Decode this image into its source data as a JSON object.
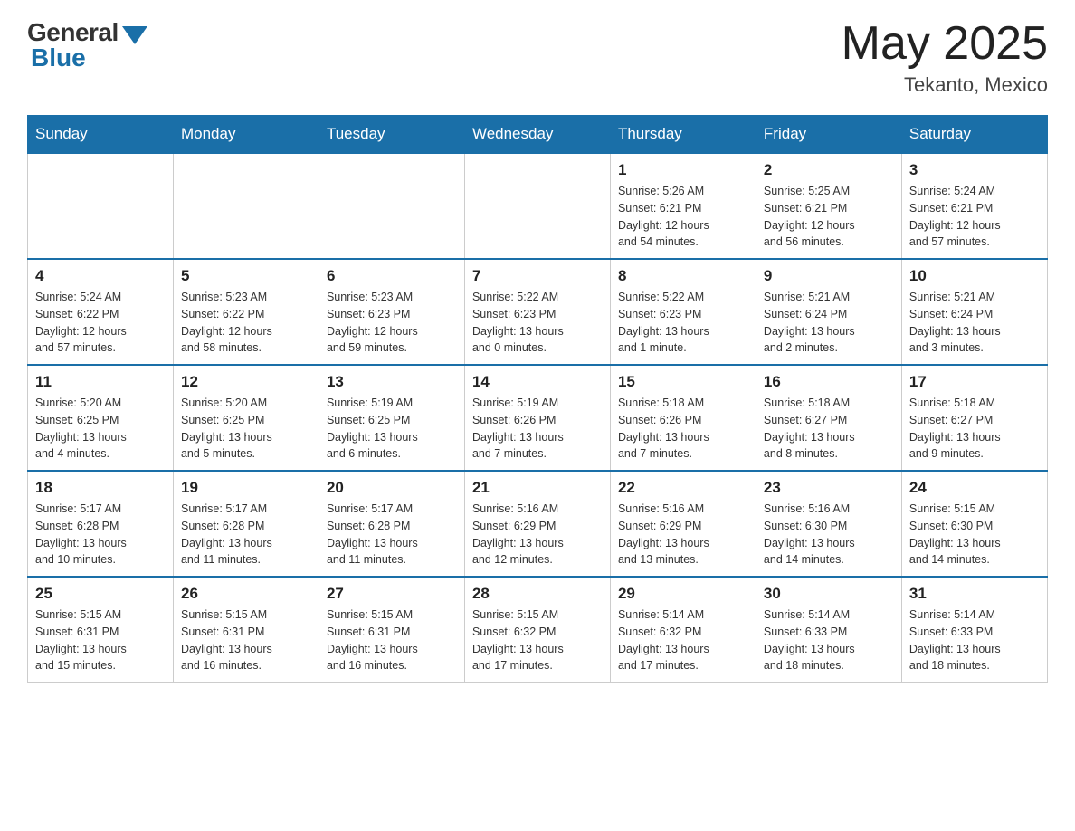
{
  "logo": {
    "general": "General",
    "blue": "Blue"
  },
  "title": {
    "month_year": "May 2025",
    "location": "Tekanto, Mexico"
  },
  "weekdays": [
    "Sunday",
    "Monday",
    "Tuesday",
    "Wednesday",
    "Thursday",
    "Friday",
    "Saturday"
  ],
  "weeks": [
    [
      {
        "day": "",
        "info": ""
      },
      {
        "day": "",
        "info": ""
      },
      {
        "day": "",
        "info": ""
      },
      {
        "day": "",
        "info": ""
      },
      {
        "day": "1",
        "info": "Sunrise: 5:26 AM\nSunset: 6:21 PM\nDaylight: 12 hours\nand 54 minutes."
      },
      {
        "day": "2",
        "info": "Sunrise: 5:25 AM\nSunset: 6:21 PM\nDaylight: 12 hours\nand 56 minutes."
      },
      {
        "day": "3",
        "info": "Sunrise: 5:24 AM\nSunset: 6:21 PM\nDaylight: 12 hours\nand 57 minutes."
      }
    ],
    [
      {
        "day": "4",
        "info": "Sunrise: 5:24 AM\nSunset: 6:22 PM\nDaylight: 12 hours\nand 57 minutes."
      },
      {
        "day": "5",
        "info": "Sunrise: 5:23 AM\nSunset: 6:22 PM\nDaylight: 12 hours\nand 58 minutes."
      },
      {
        "day": "6",
        "info": "Sunrise: 5:23 AM\nSunset: 6:23 PM\nDaylight: 12 hours\nand 59 minutes."
      },
      {
        "day": "7",
        "info": "Sunrise: 5:22 AM\nSunset: 6:23 PM\nDaylight: 13 hours\nand 0 minutes."
      },
      {
        "day": "8",
        "info": "Sunrise: 5:22 AM\nSunset: 6:23 PM\nDaylight: 13 hours\nand 1 minute."
      },
      {
        "day": "9",
        "info": "Sunrise: 5:21 AM\nSunset: 6:24 PM\nDaylight: 13 hours\nand 2 minutes."
      },
      {
        "day": "10",
        "info": "Sunrise: 5:21 AM\nSunset: 6:24 PM\nDaylight: 13 hours\nand 3 minutes."
      }
    ],
    [
      {
        "day": "11",
        "info": "Sunrise: 5:20 AM\nSunset: 6:25 PM\nDaylight: 13 hours\nand 4 minutes."
      },
      {
        "day": "12",
        "info": "Sunrise: 5:20 AM\nSunset: 6:25 PM\nDaylight: 13 hours\nand 5 minutes."
      },
      {
        "day": "13",
        "info": "Sunrise: 5:19 AM\nSunset: 6:25 PM\nDaylight: 13 hours\nand 6 minutes."
      },
      {
        "day": "14",
        "info": "Sunrise: 5:19 AM\nSunset: 6:26 PM\nDaylight: 13 hours\nand 7 minutes."
      },
      {
        "day": "15",
        "info": "Sunrise: 5:18 AM\nSunset: 6:26 PM\nDaylight: 13 hours\nand 7 minutes."
      },
      {
        "day": "16",
        "info": "Sunrise: 5:18 AM\nSunset: 6:27 PM\nDaylight: 13 hours\nand 8 minutes."
      },
      {
        "day": "17",
        "info": "Sunrise: 5:18 AM\nSunset: 6:27 PM\nDaylight: 13 hours\nand 9 minutes."
      }
    ],
    [
      {
        "day": "18",
        "info": "Sunrise: 5:17 AM\nSunset: 6:28 PM\nDaylight: 13 hours\nand 10 minutes."
      },
      {
        "day": "19",
        "info": "Sunrise: 5:17 AM\nSunset: 6:28 PM\nDaylight: 13 hours\nand 11 minutes."
      },
      {
        "day": "20",
        "info": "Sunrise: 5:17 AM\nSunset: 6:28 PM\nDaylight: 13 hours\nand 11 minutes."
      },
      {
        "day": "21",
        "info": "Sunrise: 5:16 AM\nSunset: 6:29 PM\nDaylight: 13 hours\nand 12 minutes."
      },
      {
        "day": "22",
        "info": "Sunrise: 5:16 AM\nSunset: 6:29 PM\nDaylight: 13 hours\nand 13 minutes."
      },
      {
        "day": "23",
        "info": "Sunrise: 5:16 AM\nSunset: 6:30 PM\nDaylight: 13 hours\nand 14 minutes."
      },
      {
        "day": "24",
        "info": "Sunrise: 5:15 AM\nSunset: 6:30 PM\nDaylight: 13 hours\nand 14 minutes."
      }
    ],
    [
      {
        "day": "25",
        "info": "Sunrise: 5:15 AM\nSunset: 6:31 PM\nDaylight: 13 hours\nand 15 minutes."
      },
      {
        "day": "26",
        "info": "Sunrise: 5:15 AM\nSunset: 6:31 PM\nDaylight: 13 hours\nand 16 minutes."
      },
      {
        "day": "27",
        "info": "Sunrise: 5:15 AM\nSunset: 6:31 PM\nDaylight: 13 hours\nand 16 minutes."
      },
      {
        "day": "28",
        "info": "Sunrise: 5:15 AM\nSunset: 6:32 PM\nDaylight: 13 hours\nand 17 minutes."
      },
      {
        "day": "29",
        "info": "Sunrise: 5:14 AM\nSunset: 6:32 PM\nDaylight: 13 hours\nand 17 minutes."
      },
      {
        "day": "30",
        "info": "Sunrise: 5:14 AM\nSunset: 6:33 PM\nDaylight: 13 hours\nand 18 minutes."
      },
      {
        "day": "31",
        "info": "Sunrise: 5:14 AM\nSunset: 6:33 PM\nDaylight: 13 hours\nand 18 minutes."
      }
    ]
  ]
}
